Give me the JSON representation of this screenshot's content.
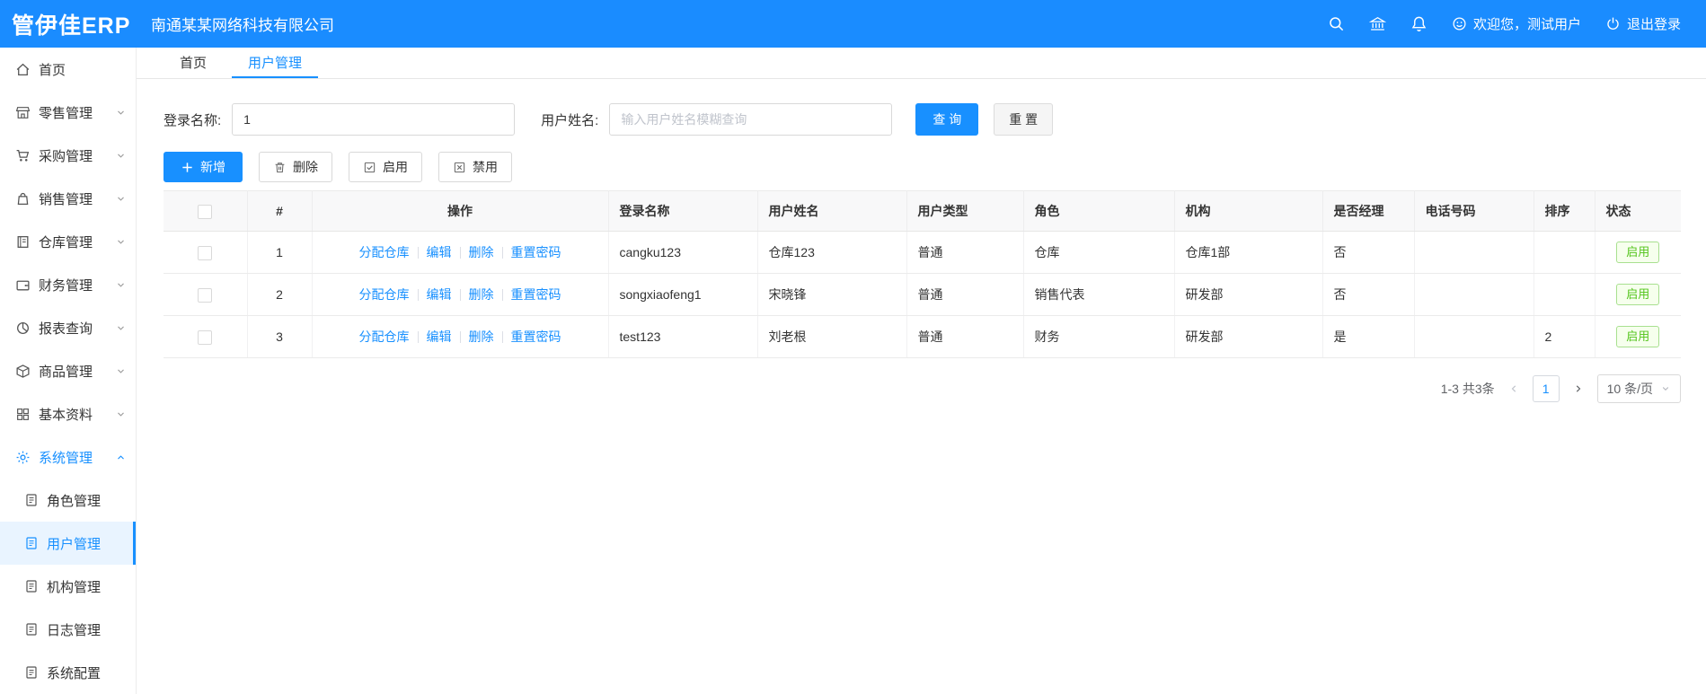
{
  "topbar": {
    "logo": "管伊佳ERP",
    "company": "南通某某网络科技有限公司",
    "welcome": "欢迎您，测试用户",
    "logout": "退出登录"
  },
  "sidebar": {
    "items": [
      {
        "label": "首页"
      },
      {
        "label": "零售管理"
      },
      {
        "label": "采购管理"
      },
      {
        "label": "销售管理"
      },
      {
        "label": "仓库管理"
      },
      {
        "label": "财务管理"
      },
      {
        "label": "报表查询"
      },
      {
        "label": "商品管理"
      },
      {
        "label": "基本资料"
      },
      {
        "label": "系统管理"
      }
    ],
    "system_children": [
      {
        "label": "角色管理"
      },
      {
        "label": "用户管理"
      },
      {
        "label": "机构管理"
      },
      {
        "label": "日志管理"
      },
      {
        "label": "系统配置"
      }
    ]
  },
  "tabs": [
    {
      "label": "首页"
    },
    {
      "label": "用户管理"
    }
  ],
  "filters": {
    "login_label": "登录名称:",
    "login_value": "1",
    "name_label": "用户姓名:",
    "name_placeholder": "输入用户姓名模糊查询",
    "search_button": "查 询",
    "reset_button": "重 置"
  },
  "toolbar": {
    "add": "新增",
    "delete": "删除",
    "enable": "启用",
    "disable": "禁用"
  },
  "table": {
    "headers": {
      "index": "#",
      "actions": "操作",
      "login": "登录名称",
      "name": "用户姓名",
      "type": "用户类型",
      "role": "角色",
      "org": "机构",
      "manager": "是否经理",
      "phone": "电话号码",
      "sort": "排序",
      "status": "状态"
    },
    "action_links": [
      "分配仓库",
      "编辑",
      "删除",
      "重置密码"
    ],
    "rows": [
      {
        "index": "1",
        "login": "cangku123",
        "name": "仓库123",
        "type": "普通",
        "role": "仓库",
        "org": "仓库1部",
        "manager": "否",
        "phone": "",
        "sort": "",
        "status": "启用"
      },
      {
        "index": "2",
        "login": "songxiaofeng1",
        "name": "宋晓锋",
        "type": "普通",
        "role": "销售代表",
        "org": "研发部",
        "manager": "否",
        "phone": "",
        "sort": "",
        "status": "启用"
      },
      {
        "index": "3",
        "login": "test123",
        "name": "刘老根",
        "type": "普通",
        "role": "财务",
        "org": "研发部",
        "manager": "是",
        "phone": "",
        "sort": "2",
        "status": "启用"
      }
    ]
  },
  "pagination": {
    "total": "1-3 共3条",
    "current_page": "1",
    "page_size": "10 条/页"
  },
  "colors": {
    "primary": "#1890ff",
    "success": "#52c41a"
  }
}
